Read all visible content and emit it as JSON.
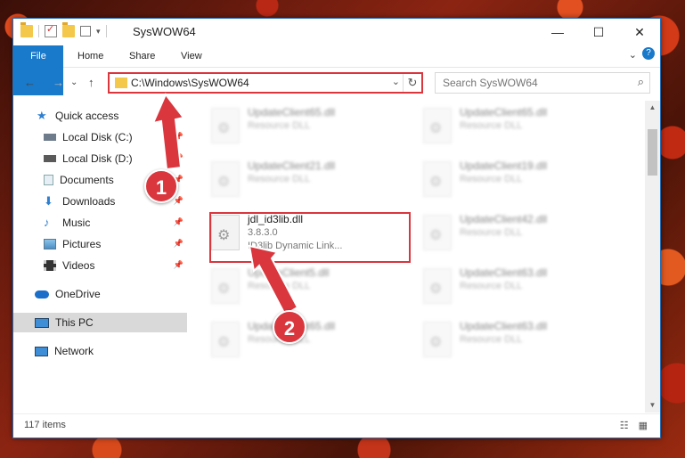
{
  "window": {
    "title": "SysWOW64",
    "controls": {
      "minimize": "—",
      "maximize": "☐",
      "close": "✕"
    }
  },
  "ribbon": {
    "tabs": [
      "File",
      "Home",
      "Share",
      "View"
    ],
    "expand_glyph": "⌄",
    "help_glyph": "?"
  },
  "navigation": {
    "back": "←",
    "forward": "→",
    "dropdown": "⌄",
    "up": "↑"
  },
  "address_bar": {
    "path": "C:\\Windows\\SysWOW64",
    "dropdown": "⌄",
    "refresh": "↻"
  },
  "search": {
    "placeholder": "Search SysWOW64",
    "icon": "⌕"
  },
  "sidebar": {
    "items": [
      {
        "label": "Quick access",
        "icon": "star-icon"
      },
      {
        "label": "Local Disk (C:)",
        "icon": "drive-icon",
        "pinned": true
      },
      {
        "label": "Local Disk (D:)",
        "icon": "drive-icon",
        "pinned": true
      },
      {
        "label": "Documents",
        "icon": "documents-icon",
        "pinned": true
      },
      {
        "label": "Downloads",
        "icon": "downloads-icon",
        "pinned": true
      },
      {
        "label": "Music",
        "icon": "music-icon",
        "pinned": true
      },
      {
        "label": "Pictures",
        "icon": "pictures-icon",
        "pinned": true
      },
      {
        "label": "Videos",
        "icon": "videos-icon",
        "pinned": true
      },
      {
        "label": "OneDrive",
        "icon": "onedrive-icon"
      },
      {
        "label": "This PC",
        "icon": "pc-icon",
        "selected": true
      },
      {
        "label": "Network",
        "icon": "network-icon"
      }
    ]
  },
  "files": [
    {
      "name": "UpdateClient65.dll",
      "desc": "Resource DLL"
    },
    {
      "name": "UpdateClient65.dll",
      "desc": "Resource DLL"
    },
    {
      "name": "UpdateClient21.dll",
      "desc": "Resource DLL"
    },
    {
      "name": "UpdateClient19.dll",
      "desc": "Resource DLL"
    },
    {
      "name": "jdl_id3lib.dll",
      "desc": "3.8.3.0",
      "desc2": "ID3lib Dynamic Link...",
      "highlighted": true
    },
    {
      "name": "UpdateClient42.dll",
      "desc": "Resource DLL"
    },
    {
      "name": "UpdateClient5.dll",
      "desc": "Resource DLL"
    },
    {
      "name": "UpdateClient63.dll",
      "desc": "Resource DLL"
    },
    {
      "name": "UpdateClient65.dll",
      "desc": "Resource DLL"
    },
    {
      "name": "UpdateClient63.dll",
      "desc": "Resource DLL"
    }
  ],
  "status": {
    "item_count": "117 items",
    "view_icons": "☷ ▦"
  },
  "callouts": [
    "1",
    "2"
  ],
  "colors": {
    "highlight": "#d9363e",
    "file_tab": "#1979ca",
    "selection": "#d9d9d9"
  }
}
